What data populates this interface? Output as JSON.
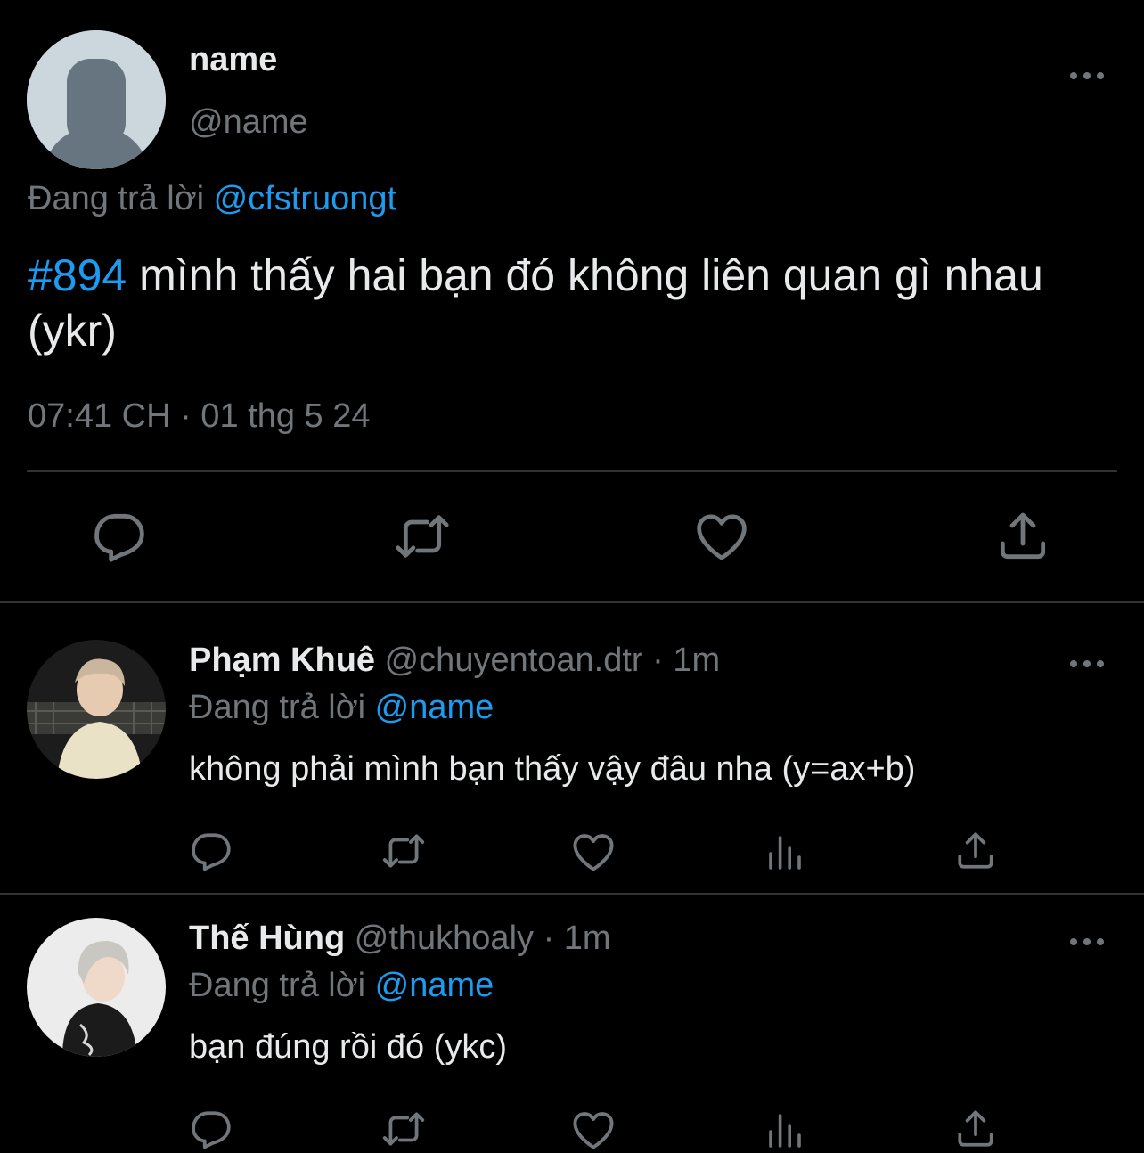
{
  "main_tweet": {
    "name": "name",
    "handle": "@name",
    "reply_prefix": "Đang trả lời",
    "reply_to": "@cfstruongt",
    "hashtag": "#894",
    "text": " mình thấy hai bạn đó không liên quan gì nhau (ykr)",
    "timestamp": "07:41 CH · 01 thg 5 24"
  },
  "replies": [
    {
      "name": "Phạm Khuê",
      "handle": "@chuyentoan.dtr",
      "time": " · 1m",
      "reply_prefix": "Đang trả lời",
      "reply_to": "@name",
      "text": "không phải mình bạn thấy vậy đâu nha (y=ax+b)"
    },
    {
      "name": "Thế Hùng",
      "handle": "@thukhoaly",
      "time": " · 1m",
      "reply_prefix": "Đang trả lời",
      "reply_to": "@name",
      "text": "bạn đúng rồi đó (ykc)"
    }
  ],
  "icons": [
    "reply-icon",
    "retweet-icon",
    "like-icon",
    "share-icon",
    "analytics-icon",
    "more-icon"
  ],
  "colors": {
    "background": "#000000",
    "text": "#e7e9ea",
    "muted": "#71767b",
    "link": "#1d9bf0",
    "divider": "#2f3336",
    "default_avatar": "#ccd6dd"
  }
}
